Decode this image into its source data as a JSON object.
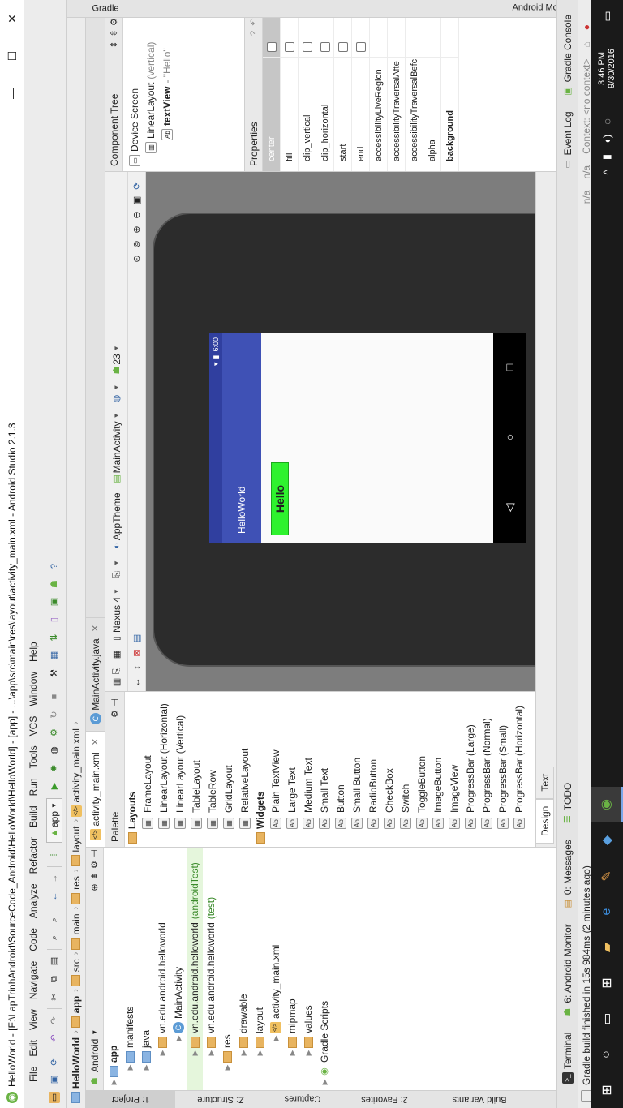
{
  "window": {
    "title": "HelloWorld - [F:\\LapTrinhAndroid\\SourceCode_Android\\HelloWorld\\HelloWorld] - [app] - ...\\app\\src\\main\\res\\layout\\activity_main.xml - Android Studio 2.1.3",
    "minimize": "—",
    "maximize": "☐",
    "close": "✕"
  },
  "menu": [
    "File",
    "Edit",
    "View",
    "Navigate",
    "Code",
    "Analyze",
    "Refactor",
    "Build",
    "Run",
    "Tools",
    "VCS",
    "Window",
    "Help"
  ],
  "toolbar": {
    "run_config": "app"
  },
  "breadcrumb": [
    "HelloWorld",
    "app",
    "src",
    "main",
    "res",
    "layout",
    "activity_main.xml"
  ],
  "left_tabs": {
    "project": "1: Project",
    "structure": "Z: Structure",
    "captures": "Captures",
    "favorites": "2: Favorites",
    "build_variants": "Build Variants"
  },
  "project": {
    "view": "Android",
    "tree": [
      {
        "label": "app",
        "indent": 0,
        "bold": true
      },
      {
        "label": "manifests",
        "indent": 1
      },
      {
        "label": "java",
        "indent": 1
      },
      {
        "label": "vn.edu.android.helloworld",
        "indent": 2
      },
      {
        "label": "MainActivity",
        "indent": 3
      },
      {
        "label": "vn.edu.android.helloworld",
        "suffix": "(androidTest)",
        "indent": 2,
        "hl": true
      },
      {
        "label": "vn.edu.android.helloworld",
        "suffix": "(test)",
        "indent": 2
      },
      {
        "label": "res",
        "indent": 1
      },
      {
        "label": "drawable",
        "indent": 2
      },
      {
        "label": "layout",
        "indent": 2
      },
      {
        "label": "activity_main.xml",
        "indent": 3
      },
      {
        "label": "mipmap",
        "indent": 2
      },
      {
        "label": "values",
        "indent": 2
      },
      {
        "label": "Gradle Scripts",
        "indent": 0
      }
    ]
  },
  "editor_tabs": [
    {
      "label": "activity_main.xml",
      "active": true,
      "close": "✕"
    },
    {
      "label": "MainActivity.java",
      "active": false,
      "close": "✕"
    }
  ],
  "palette": {
    "title": "Palette",
    "sections": [
      {
        "title": "Layouts",
        "items": [
          "FrameLayout",
          "LinearLayout (Horizontal)",
          "LinearLayout (Vertical)",
          "TableLayout",
          "TableRow",
          "GridLayout",
          "RelativeLayout"
        ]
      },
      {
        "title": "Widgets",
        "items": [
          "Plain TextView",
          "Large Text",
          "Medium Text",
          "Small Text",
          "Button",
          "Small Button",
          "RadioButton",
          "CheckBox",
          "Switch",
          "ToggleButton",
          "ImageButton",
          "ImageView",
          "ProgressBar (Large)",
          "ProgressBar (Normal)",
          "ProgressBar (Small)",
          "ProgressBar (Horizontal)"
        ]
      }
    ]
  },
  "design_toolbar": {
    "device": "Nexus 4",
    "theme": "AppTheme",
    "activity": "MainActivity",
    "api": "23"
  },
  "phone": {
    "time": "6:00",
    "app_title": "HelloWorld",
    "text": "Hello",
    "nav_back": "◁",
    "nav_home": "○",
    "nav_recent": "□"
  },
  "design_tabs": [
    "Design",
    "Text"
  ],
  "component_tree": {
    "title": "Component Tree",
    "items": [
      {
        "label": "Device Screen",
        "indent": 0
      },
      {
        "label": "LinearLayout",
        "suffix": "(vertical)",
        "indent": 1
      },
      {
        "label": "textView",
        "suffix": "- \"Hello\"",
        "indent": 2,
        "bold": true
      }
    ]
  },
  "properties": {
    "title": "Properties",
    "rows": [
      {
        "name": "center",
        "type": "check",
        "selected": true
      },
      {
        "name": "fill",
        "type": "check"
      },
      {
        "name": "clip_vertical",
        "type": "check"
      },
      {
        "name": "clip_horizontal",
        "type": "check"
      },
      {
        "name": "start",
        "type": "check"
      },
      {
        "name": "end",
        "type": "check"
      },
      {
        "name": "accessibilityLiveRegion",
        "type": "text"
      },
      {
        "name": "accessibilityTraversalAfte",
        "type": "text"
      },
      {
        "name": "accessibilityTraversalBefc",
        "type": "text"
      },
      {
        "name": "alpha",
        "type": "text"
      },
      {
        "name": "background",
        "type": "text",
        "bold": true
      }
    ]
  },
  "right_tabs": {
    "gradle": "Gradle",
    "android_model": "Android Model"
  },
  "bottom_tabs": [
    "Terminal",
    "6: Android Monitor",
    "0: Messages",
    "TODO"
  ],
  "bottom_right_tabs": [
    "Event Log",
    "Gradle Console"
  ],
  "status": {
    "message": "Gradle build finished in 15s 984ms (2 minutes ago)",
    "pos1": "n/a",
    "pos2": "n/a",
    "context": "Context: <no context>"
  },
  "taskbar": {
    "time": "3:46 PM",
    "date": "9/30/2016"
  },
  "colors": {
    "accent": "#3f51b5",
    "accent_dark": "#303f9f",
    "selection": "#2ef22e"
  }
}
